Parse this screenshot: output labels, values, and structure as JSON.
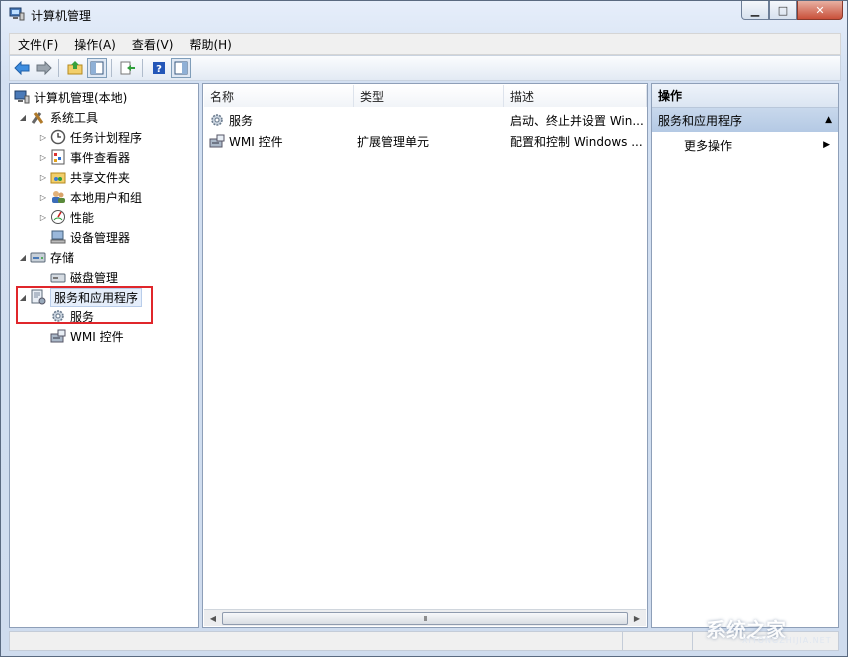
{
  "window": {
    "title": "计算机管理"
  },
  "menu": [
    {
      "label": "文件(F)"
    },
    {
      "label": "操作(A)"
    },
    {
      "label": "查看(V)"
    },
    {
      "label": "帮助(H)"
    }
  ],
  "toolbar": {
    "icons": [
      "back-arrow-icon",
      "forward-arrow-icon",
      "up-folder-icon",
      "show-hide-tree-icon",
      "export-list-icon",
      "help-icon",
      "show-hide-action-pane-icon"
    ]
  },
  "tree": {
    "root": "计算机管理(本地)",
    "system_tools": "系统工具",
    "task_scheduler": "任务计划程序",
    "event_viewer": "事件查看器",
    "shared_folders": "共享文件夹",
    "local_users": "本地用户和组",
    "performance": "性能",
    "device_manager": "设备管理器",
    "storage": "存储",
    "disk_management": "磁盘管理",
    "services_apps": "服务和应用程序",
    "services": "服务",
    "wmi": "WMI 控件"
  },
  "list": {
    "columns": [
      "名称",
      "类型",
      "描述"
    ],
    "rows": [
      {
        "name": "服务",
        "type": "",
        "desc": "启动、终止并设置 Win..."
      },
      {
        "name": "WMI 控件",
        "type": "扩展管理单元",
        "desc": "配置和控制 Windows ..."
      }
    ],
    "scroll_grip": "III"
  },
  "actions": {
    "header": "操作",
    "section": "服务和应用程序",
    "more": "更多操作"
  },
  "watermark": {
    "text": "系统之家",
    "sub": "XITONGZHIJIA.NET"
  },
  "colors": {
    "highlight_box": "#e0262b",
    "action_section": "#b4c9e4"
  }
}
